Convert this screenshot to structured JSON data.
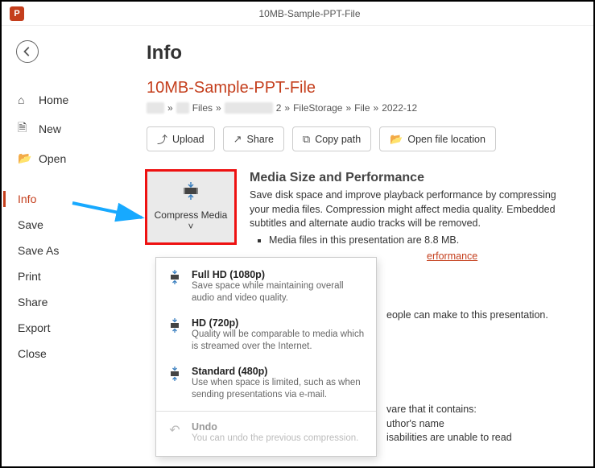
{
  "window_title": "10MB-Sample-PPT-File",
  "app_letter": "P",
  "sidebar": {
    "groups": [
      {
        "items": [
          {
            "key": "home",
            "label": "Home",
            "icon": "⌂"
          },
          {
            "key": "new",
            "label": "New",
            "icon": "🗎"
          },
          {
            "key": "open",
            "label": "Open",
            "icon": "📂"
          }
        ]
      },
      {
        "items": [
          {
            "key": "info",
            "label": "Info",
            "icon": "",
            "active": true
          },
          {
            "key": "save",
            "label": "Save",
            "icon": ""
          },
          {
            "key": "saveas",
            "label": "Save As",
            "icon": ""
          },
          {
            "key": "print",
            "label": "Print",
            "icon": ""
          },
          {
            "key": "share",
            "label": "Share",
            "icon": ""
          },
          {
            "key": "export",
            "label": "Export",
            "icon": ""
          },
          {
            "key": "close",
            "label": "Close",
            "icon": ""
          }
        ]
      }
    ]
  },
  "page": {
    "title": "Info",
    "doc_title": "10MB-Sample-PPT-File",
    "breadcrumb": [
      "",
      "Files",
      "",
      "2",
      "FileStorage",
      "File",
      "2022-12"
    ]
  },
  "actions": [
    {
      "key": "upload",
      "label": "Upload",
      "icon": "⤴"
    },
    {
      "key": "share",
      "label": "Share",
      "icon": "↗"
    },
    {
      "key": "copypath",
      "label": "Copy path",
      "icon": "⧉"
    },
    {
      "key": "openloc",
      "label": "Open file location",
      "icon": "📂"
    }
  ],
  "compress": {
    "button_label": "Compress Media",
    "section_title": "Media Size and Performance",
    "section_text": "Save disk space and improve playback performance by compressing your media files. Compression might affect media quality. Embedded subtitles and alternate audio tracks will be removed.",
    "bullet": "Media files in this presentation are 8.8 MB.",
    "link": "erformance",
    "menu": [
      {
        "key": "fhd",
        "title": "Full HD (1080p)",
        "desc": "Save space while maintaining overall audio and video quality."
      },
      {
        "key": "hd",
        "title": "HD (720p)",
        "desc": "Quality will be comparable to media which is streamed over the Internet."
      },
      {
        "key": "sd",
        "title": "Standard (480p)",
        "desc": "Use when space is limited, such as when sending presentations via e-mail."
      },
      {
        "key": "undo",
        "title": "Undo",
        "desc": "You can undo the previous compression.",
        "disabled": true
      }
    ]
  },
  "peek_lines": {
    "protect": "eople can make to this presentation.",
    "inspect1": "vare that it contains:",
    "inspect2": "uthor's name",
    "inspect3": "isabilities are unable to read"
  }
}
